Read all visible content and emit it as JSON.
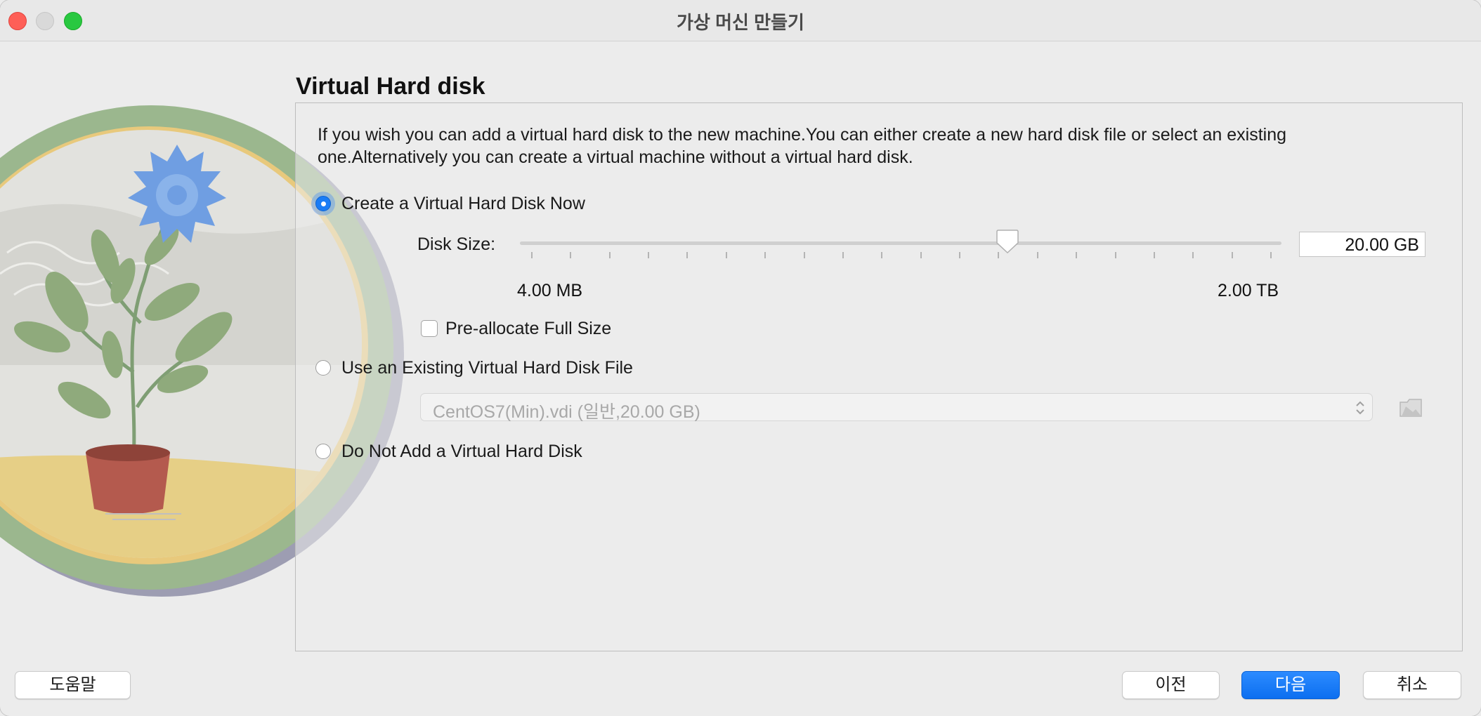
{
  "window": {
    "title": "가상 머신 만들기"
  },
  "page": {
    "heading": "Virtual Hard disk",
    "description": "If you wish you can add a virtual hard disk to the new machine.You can either create a new hard disk file or select an existing one.Alternatively you can create a virtual machine without a virtual hard disk."
  },
  "options": {
    "create_now": {
      "label": "Create a Virtual Hard Disk Now",
      "selected": true
    },
    "use_existing": {
      "label": "Use an Existing Virtual Hard Disk File",
      "selected": false
    },
    "do_not_add": {
      "label": "Do Not Add a Virtual Hard Disk",
      "selected": false
    }
  },
  "disk_size": {
    "label": "Disk Size:",
    "value": "20.00 GB",
    "min_label": "4.00 MB",
    "max_label": "2.00 TB",
    "slider_fraction": 0.64
  },
  "preallocate": {
    "label": "Pre-allocate Full Size",
    "checked": false
  },
  "existing_disk": {
    "selected": "CentOS7(Min).vdi (일반,20.00 GB)",
    "enabled": false
  },
  "buttons": {
    "help": "도움말",
    "back": "이전",
    "next": "다음",
    "cancel": "취소"
  },
  "colors": {
    "accent": "#1a7cf5",
    "close": "#fe5f57",
    "zoom": "#29c840"
  },
  "icons": [
    "close-icon",
    "minimize-icon",
    "zoom-icon",
    "folder-icon",
    "updown-chevron-icon",
    "slider-thumb-icon"
  ]
}
